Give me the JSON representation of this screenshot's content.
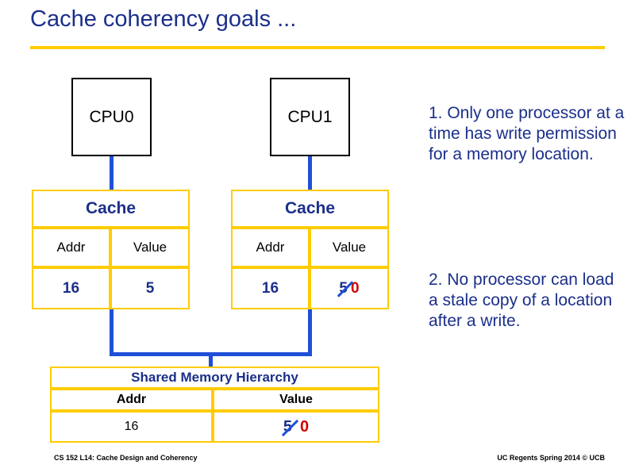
{
  "slide": {
    "title": "Cache coherency goals ...",
    "footer_left": "CS 152 L14:  Cache Design and Coherency",
    "footer_right": "UC Regents Spring 2014 © UCB",
    "accent_rule_color": "#ffcc00",
    "title_color": "#1b2f8a"
  },
  "cpus": [
    {
      "label": "CPU0"
    },
    {
      "label": "CPU1"
    }
  ],
  "caches": [
    {
      "title": "Cache",
      "headers": {
        "addr": "Addr",
        "value": "Value"
      },
      "row": {
        "addr": "16",
        "value": "5"
      }
    },
    {
      "title": "Cache",
      "headers": {
        "addr": "Addr",
        "value": "Value"
      },
      "row": {
        "addr": "16",
        "old_value": "5",
        "new_value": "0",
        "struck": true
      }
    }
  ],
  "shared_memory": {
    "title": "Shared Memory Hierarchy",
    "headers": {
      "addr": "Addr",
      "value": "Value"
    },
    "row": {
      "addr": "16",
      "old_value": "5",
      "new_value": "0",
      "struck": true
    }
  },
  "notes": [
    "1. Only one processor at a time has write permission for a memory location.",
    "2. No processor can load a stale copy of a location after a write."
  ],
  "colors": {
    "wire": "#1f4fd8",
    "old_value": "#1b2f8a",
    "new_value": "#d40000",
    "cell_border": "#ffcc00"
  }
}
